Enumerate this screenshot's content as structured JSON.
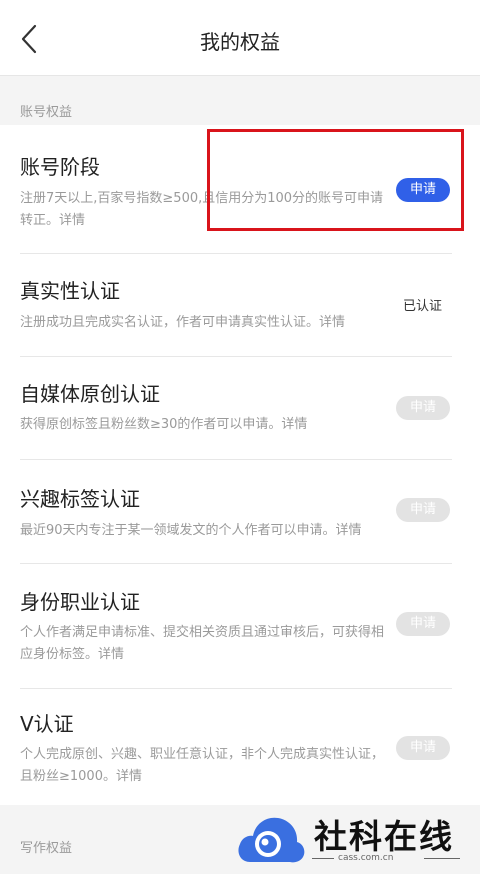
{
  "header": {
    "title": "我的权益",
    "back_icon": "chevron-left-icon"
  },
  "sections": {
    "account": {
      "label": "账号权益"
    },
    "writing": {
      "label": "写作权益"
    }
  },
  "items": [
    {
      "title": "账号阶段",
      "desc": "注册7天以上,百家号指数≥500,且信用分为100分的账号可申请转正。详情",
      "action": "申请",
      "action_state": "active"
    },
    {
      "title": "真实性认证",
      "desc": "注册成功且完成实名认证，作者可申请真实性认证。详情",
      "action": "已认证",
      "action_state": "status"
    },
    {
      "title": "自媒体原创认证",
      "desc": "获得原创标签且粉丝数≥30的作者可以申请。详情",
      "action": "申请",
      "action_state": "disabled"
    },
    {
      "title": "兴趣标签认证",
      "desc": "最近90天内专注于某一领域发文的个人作者可以申请。详情",
      "action": "申请",
      "action_state": "disabled"
    },
    {
      "title": "身份职业认证",
      "desc": "个人作者满足申请标准、提交相关资质且通过审核后，可获得相应身份标签。详情",
      "action": "申请",
      "action_state": "disabled"
    },
    {
      "title": "V认证",
      "desc": "个人完成原创、兴趣、职业任意认证，非个人完成真实性认证，且粉丝≥1000。详情",
      "action": "申请",
      "action_state": "disabled"
    }
  ],
  "annotation": {
    "color": "#d9141b"
  },
  "watermark": {
    "text": "社科在线",
    "domain": "cass.com.cn"
  },
  "colors": {
    "accent": "#3060e8",
    "disabled_pill": "#e3e3e3",
    "secondary_text": "#9a9a9a"
  }
}
